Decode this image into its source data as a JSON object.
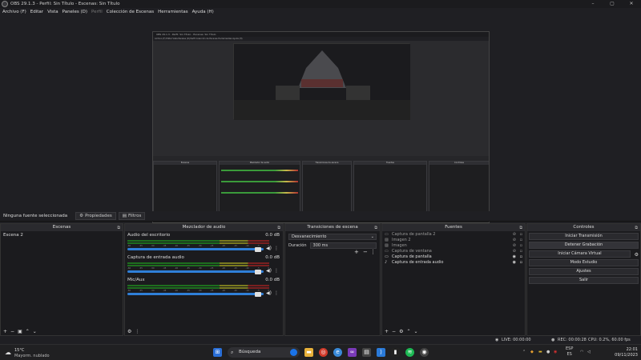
{
  "window": {
    "title": "OBS 29.1.3 - Perfil: Sin Título - Escenas: Sin Título",
    "minimize": "–",
    "maximize": "▢",
    "close": "✕"
  },
  "menu": [
    "Archivo (F)",
    "Editar",
    "Vista",
    "Paneles (D)",
    "Perfil",
    "Colección de Escenas",
    "Herramientas",
    "Ayuda (H)"
  ],
  "source_toolbar": {
    "no_source": "Ninguna fuente seleccionada",
    "properties": "Propiedades",
    "filters": "Filtros"
  },
  "scenes": {
    "title": "Escenas",
    "items": [
      "Escena 2"
    ]
  },
  "mixer": {
    "title": "Mezclador de audio",
    "channels": [
      {
        "name": "Audio del escritorio",
        "db": "0.0 dB"
      },
      {
        "name": "Captura de entrada audio",
        "db": "0.0 dB"
      },
      {
        "name": "Mic/Aux",
        "db": "0.0 dB"
      }
    ],
    "ticks": [
      "-60",
      "-55",
      "-50",
      "-45",
      "-40",
      "-35",
      "-30",
      "-25",
      "-20",
      "-15",
      "-10",
      "-5",
      "0"
    ]
  },
  "transitions": {
    "title": "Transiciones de escena",
    "selected": "Desvanecimiento",
    "duration_label": "Duración",
    "duration_value": "300 ms"
  },
  "sources": {
    "title": "Fuentes",
    "items": [
      {
        "name": "Captura de pantalla 2",
        "dim": true,
        "icon": "▭"
      },
      {
        "name": "Imagen 2",
        "dim": true,
        "icon": "▨"
      },
      {
        "name": "Imagen",
        "dim": true,
        "icon": "▨"
      },
      {
        "name": "Captura de ventana",
        "dim": true,
        "icon": "▭"
      },
      {
        "name": "Captura de pantalla",
        "dim": false,
        "icon": "▭"
      },
      {
        "name": "Captura de entrada audio",
        "dim": false,
        "icon": "♪"
      }
    ]
  },
  "controls": {
    "title": "Controles",
    "buttons": [
      "Iniciar Transmisión",
      "Detener Grabación",
      "Iniciar Cámara Virtual",
      "Modo Estudio",
      "Ajustes",
      "Salir"
    ]
  },
  "status": {
    "live": "LIVE: 00:00:00",
    "rec": "REC: 00:00:28",
    "cpu": "CPU: 0.2%, 60.00 fps"
  },
  "taskbar": {
    "temperature": "15°C",
    "weather": "Mayorm. nublado",
    "search": "Búsqueda",
    "lang1": "ESP",
    "lang2": "ES",
    "time": "22:01",
    "date": "09/11/2023"
  },
  "preview_nested": {
    "title": "OBS 29.1.3 - Perfil: Sin Título - Escenas: Sin Título",
    "menu": "Archivo (F)   Editar   Vista   Paneles (D)   Perfil   Colección de Escenas   Herramientas   Ayuda (H)",
    "scenes": "Escenas",
    "mixer": "Mezclador de audio",
    "transitions": "Transiciones de escena",
    "sources": "Fuentes",
    "controls": "Controles"
  }
}
